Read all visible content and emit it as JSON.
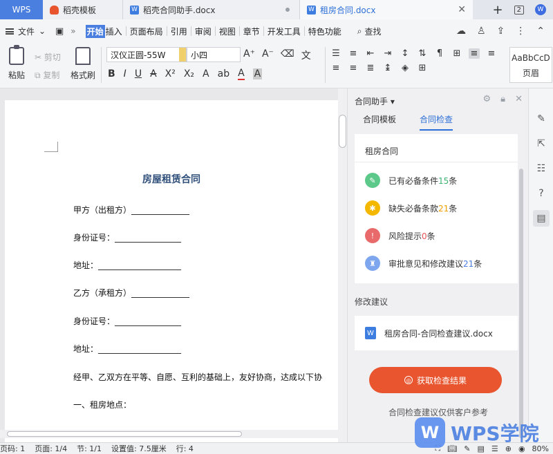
{
  "titlebar": {
    "tabs": [
      {
        "label": "WPS"
      },
      {
        "label": "稻壳模板"
      },
      {
        "label": "稻壳合同助手.docx"
      },
      {
        "label": "租房合同.docx"
      }
    ],
    "window_count": "2"
  },
  "menubar": {
    "file_label": "文件",
    "items": [
      "开始",
      "插入",
      "页面布局",
      "引用",
      "审阅",
      "视图",
      "章节",
      "开发工具",
      "特色功能"
    ],
    "search_label": "查找"
  },
  "ribbon": {
    "paste_label": "粘贴",
    "cut_label": "剪切",
    "copy_label": "复制",
    "format_painter_label": "格式刷",
    "font_name": "汉仪正圆-55W",
    "font_size": "小四",
    "style_preview": "AaBbCcD",
    "style_name": "页眉"
  },
  "document": {
    "title": "房屋租赁合同",
    "lines": [
      "甲方（出租方）______________",
      "身份证号：________________",
      "地址：____________________",
      "乙方（承租方）______________",
      "身份证号：________________",
      "地址：____________________",
      "经甲、乙双方在平等、自愿、互利的基础上，友好协商，达成以下协",
      "一、租房地点："
    ]
  },
  "panel": {
    "header": "合同助手",
    "tabs": [
      "合同模板",
      "合同检查"
    ],
    "card_title": "租房合同",
    "rows": [
      {
        "prefix": "已有必备条件",
        "count": "15",
        "suffix": "条"
      },
      {
        "prefix": "缺失必备条款",
        "count": "21",
        "suffix": "条"
      },
      {
        "prefix": "风险提示",
        "count": "0",
        "suffix": "条"
      },
      {
        "prefix": "审批意见和修改建议",
        "count": "21",
        "suffix": "条"
      }
    ],
    "suggest_title": "修改建议",
    "suggest_file": "租房合同-合同检查建议.docx",
    "button_label": "获取检查结果",
    "note": "合同检查建议仅供客户参考"
  },
  "status": {
    "page_code": "页码: 1",
    "page": "页面: 1/4",
    "section": "节: 1/1",
    "setting": "设置值: 7.5厘米",
    "row": "行: 4",
    "zoom": "80%"
  },
  "watermark": {
    "text": "WPS学院"
  },
  "colors": {
    "accent": "#4a7fe0",
    "button": "#e8552e"
  }
}
